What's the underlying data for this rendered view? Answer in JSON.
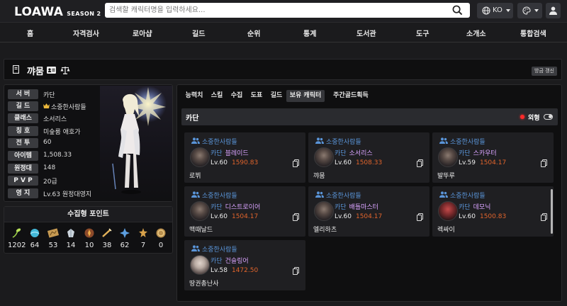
{
  "header": {
    "logo": "LOAWA",
    "season": "SEASON 2",
    "search_placeholder": "검색할 캐릭터명을 입력하세요...",
    "lang": "KO"
  },
  "nav": [
    "홈",
    "자격검사",
    "로아샵",
    "길드",
    "순위",
    "통계",
    "도서관",
    "도구",
    "소개소",
    "통합검색"
  ],
  "profile": {
    "name": "꺄뭄",
    "refresh_label": "방금 갱신"
  },
  "info": [
    {
      "label": "서 버",
      "value": "카단"
    },
    {
      "label": "길 드",
      "value": "소중한사람들"
    },
    {
      "label": "클래스",
      "value": "소서리스"
    },
    {
      "label": "칭 호",
      "value": "미숲룸 애호가"
    },
    {
      "label": "전 투",
      "value": "60"
    },
    {
      "label": "아이템",
      "value": "1,508.33"
    },
    {
      "label": "원정대",
      "value": "148"
    },
    {
      "label": "P V P",
      "value": "20급"
    },
    {
      "label": "영 지",
      "value": "Lv.63 원정대영지"
    }
  ],
  "collect": {
    "title": "수집형 포인트",
    "counts": [
      "1202",
      "64",
      "53",
      "14",
      "10",
      "38",
      "62",
      "7",
      "0"
    ]
  },
  "tabs": [
    "능력치",
    "스킬",
    "수집",
    "도표",
    "길드",
    "보유 캐릭터",
    "주간골드획득"
  ],
  "server": {
    "name": "카단",
    "outlook_label": "외형"
  },
  "chars": [
    {
      "guild": "소중한사람들",
      "server": "카단",
      "cls": "블레이드",
      "lv": "Lv.60",
      "ilvl": "1590.83",
      "name": "로뷔"
    },
    {
      "guild": "소중한사람들",
      "server": "카단",
      "cls": "소서리스",
      "lv": "Lv.60",
      "ilvl": "1508.33",
      "name": "꺄뭄"
    },
    {
      "guild": "소중한사람들",
      "server": "카단",
      "cls": "스카우터",
      "lv": "Lv.59",
      "ilvl": "1504.17",
      "name": "발뚜루"
    },
    {
      "guild": "소중한사람들",
      "server": "카단",
      "cls": "디스트로이어",
      "lv": "Lv.60",
      "ilvl": "1504.17",
      "name": "맥때날드"
    },
    {
      "guild": "소중한사람들",
      "server": "카단",
      "cls": "배틀마스터",
      "lv": "Lv.60",
      "ilvl": "1504.17",
      "name": "엘리하츠"
    },
    {
      "guild": "소중한사람들",
      "server": "카단",
      "cls": "데모닉",
      "lv": "Lv.60",
      "ilvl": "1500.83",
      "name": "렉싸이"
    },
    {
      "guild": "소중한사람들",
      "server": "카단",
      "cls": "건슬링어",
      "lv": "Lv.58",
      "ilvl": "1472.50",
      "name": "땅권총난사"
    }
  ]
}
